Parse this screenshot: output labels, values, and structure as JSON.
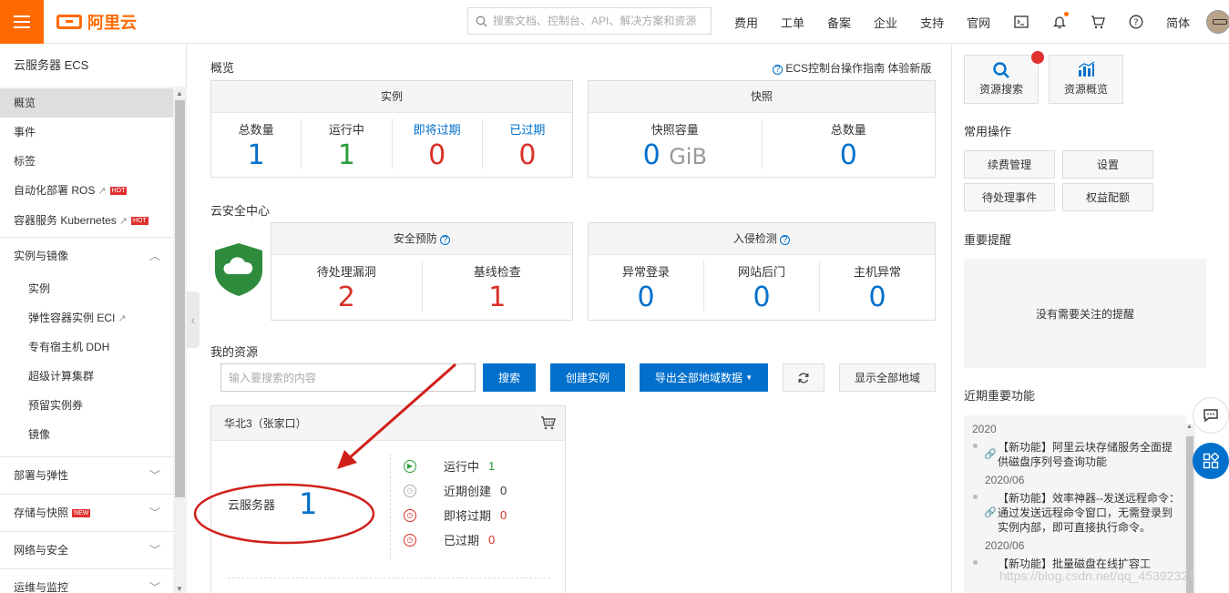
{
  "topbar": {
    "logo": "阿里云",
    "search_placeholder": "搜索文档、控制台、API、解决方案和资源",
    "nav": [
      "费用",
      "工单",
      "备案",
      "企业",
      "支持",
      "官网"
    ],
    "lang": "简体"
  },
  "sidebar": {
    "title": "云服务器 ECS",
    "items": [
      "概览",
      "事件",
      "标签",
      "自动化部署 ROS",
      "容器服务 Kubernetes"
    ],
    "hot": "HOT",
    "new": "NEW",
    "group_instances": "实例与镜像",
    "sub_items": [
      "实例",
      "弹性容器实例 ECI",
      "专有宿主机 DDH",
      "超级计算集群",
      "预留实例券",
      "镜像"
    ],
    "groups": [
      "部署与弹性",
      "存储与快照",
      "网络与安全",
      "运维与监控"
    ]
  },
  "overview": {
    "title": "概览",
    "guide_link": "ECS控制台操作指南",
    "new_version_link": "体验新版",
    "instances": {
      "head": "实例",
      "labels": [
        "总数量",
        "运行中",
        "即将过期",
        "已过期"
      ],
      "values": [
        "1",
        "1",
        "0",
        "0"
      ]
    },
    "snapshots": {
      "head": "快照",
      "labels": [
        "快照容量",
        "总数量"
      ],
      "capacity": "0",
      "unit": "GiB",
      "total": "0"
    }
  },
  "security": {
    "title": "云安全中心",
    "protect": {
      "head": "安全预防",
      "labels": [
        "待处理漏洞",
        "基线检查"
      ],
      "values": [
        "2",
        "1"
      ]
    },
    "intrusion": {
      "head": "入侵检测",
      "labels": [
        "异常登录",
        "网站后门",
        "主机异常"
      ],
      "values": [
        "0",
        "0",
        "0"
      ]
    }
  },
  "resources": {
    "title": "我的资源",
    "search_placeholder": "输入要搜索的内容",
    "btn_search": "搜索",
    "btn_create": "创建实例",
    "btn_export": "导出全部地域数据",
    "btn_show_all": "显示全部地域",
    "region": "华北3（张家口）",
    "server_label": "云服务器",
    "server_count": "1",
    "status": [
      {
        "label": "运行中",
        "value": "1"
      },
      {
        "label": "近期创建",
        "value": "0"
      },
      {
        "label": "即将过期",
        "value": "0"
      },
      {
        "label": "已过期",
        "value": "0"
      }
    ]
  },
  "right": {
    "btn_resource_search": "资源搜索",
    "btn_resource_overview": "资源概览",
    "common_ops_title": "常用操作",
    "ops": [
      "续费管理",
      "设置",
      "待处理事件",
      "权益配额"
    ],
    "alerts_title": "重要提醒",
    "alerts_empty": "没有需要关注的提醒",
    "features_title": "近期重要功能",
    "features": [
      {
        "date": "2020",
        "text": "【新功能】阿里云块存储服务全面提供磁盘序列号查询功能"
      },
      {
        "date": "2020/06",
        "text": "【新功能】效率神器--发送远程命令：通过发送远程命令窗口，无需登录到实例内部，即可直接执行命令。"
      },
      {
        "date": "2020/06",
        "text": "【新功能】批量磁盘在线扩容工"
      }
    ],
    "watermark": "https://blog.csdn.net/qq_45392321"
  }
}
